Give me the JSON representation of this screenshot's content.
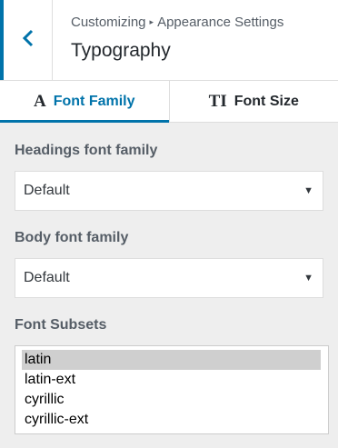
{
  "header": {
    "breadcrumb": [
      "Customizing",
      "Appearance Settings"
    ],
    "separator": "▸",
    "title": "Typography",
    "back_icon": "chevron-left-icon",
    "accent": "#0073aa"
  },
  "tabs": [
    {
      "glyph": "A",
      "label": "Font Family",
      "active": true
    },
    {
      "glyph": "TI",
      "label": "Font Size",
      "active": false
    }
  ],
  "fields": {
    "headings": {
      "label": "Headings font family",
      "value": "Default"
    },
    "body": {
      "label": "Body font family",
      "value": "Default"
    },
    "subsets": {
      "label": "Font Subsets",
      "options": [
        "latin",
        "latin-ext",
        "cyrillic",
        "cyrillic-ext"
      ],
      "selected": "latin"
    }
  },
  "select_arrow": "▼"
}
